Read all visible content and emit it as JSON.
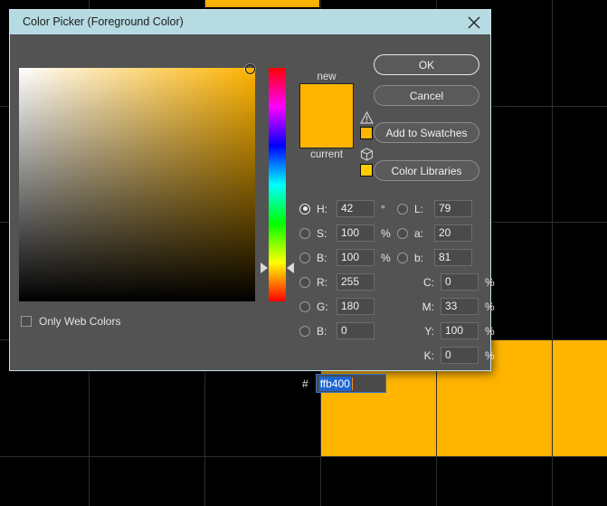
{
  "background": {
    "canvas_color": "#000000",
    "cell_color": "#ffb400",
    "grid_line_color": "#2e2e2e"
  },
  "dialog": {
    "title": "Color Picker (Foreground Color)",
    "close_icon": "close-icon",
    "titlebar_color": "#b6dbe2",
    "panel_color": "#535353"
  },
  "color_field": {
    "base_hue_color": "#ffb400",
    "marker_name": "color-field-marker"
  },
  "hue_slider": {
    "name": "hue-slider",
    "marker_left": "hue-marker-left",
    "marker_right": "hue-marker-right"
  },
  "web_colors": {
    "label": "Only Web Colors",
    "checked": false
  },
  "preview": {
    "new_label": "new",
    "current_label": "current",
    "new_color": "#ffb400",
    "current_color": "#ffb400",
    "gamut_warning_icon": "gamut-warning-icon",
    "gamut_warning_swatch_color": "#ffb400",
    "websafe_icon": "websafe-cube-icon",
    "websafe_swatch_color": "#ffcc00"
  },
  "buttons": {
    "ok": "OK",
    "cancel": "Cancel",
    "add_to_swatches": "Add to Swatches",
    "color_libraries": "Color Libraries"
  },
  "fields": {
    "hsb": [
      {
        "label": "H:",
        "value": "42",
        "unit": "°",
        "selected": true
      },
      {
        "label": "S:",
        "value": "100",
        "unit": "%",
        "selected": false
      },
      {
        "label": "B:",
        "value": "100",
        "unit": "%",
        "selected": false
      }
    ],
    "lab": [
      {
        "label": "L:",
        "value": "79",
        "unit": "",
        "selected": false
      },
      {
        "label": "a:",
        "value": "20",
        "unit": "",
        "selected": false
      },
      {
        "label": "b:",
        "value": "81",
        "unit": "",
        "selected": false
      }
    ],
    "rgb": [
      {
        "label": "R:",
        "value": "255",
        "unit": "",
        "selected": false
      },
      {
        "label": "G:",
        "value": "180",
        "unit": "",
        "selected": false
      },
      {
        "label": "B:",
        "value": "0",
        "unit": "",
        "selected": false
      }
    ],
    "cmyk": [
      {
        "label": "C:",
        "value": "0",
        "unit": "%"
      },
      {
        "label": "M:",
        "value": "33",
        "unit": "%"
      },
      {
        "label": "Y:",
        "value": "100",
        "unit": "%"
      },
      {
        "label": "K:",
        "value": "0",
        "unit": "%"
      }
    ],
    "hex": {
      "sign": "#",
      "value": "ffb400",
      "selected": true
    }
  }
}
